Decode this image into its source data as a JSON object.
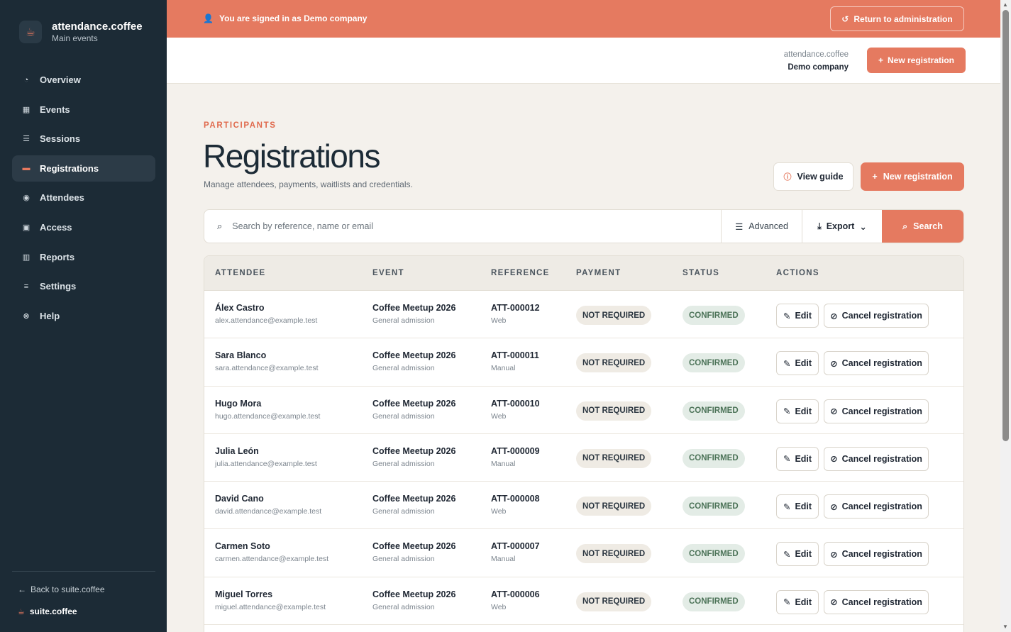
{
  "brand": {
    "name": "attendance.coffee",
    "subtitle": "Main events"
  },
  "sidebar": {
    "items": [
      {
        "label": "Overview",
        "icon": "◔"
      },
      {
        "label": "Events",
        "icon": "▦"
      },
      {
        "label": "Sessions",
        "icon": "☰"
      },
      {
        "label": "Registrations",
        "icon": "▬",
        "active": true
      },
      {
        "label": "Attendees",
        "icon": "◉"
      },
      {
        "label": "Access",
        "icon": "▣"
      },
      {
        "label": "Reports",
        "icon": "▥"
      },
      {
        "label": "Settings",
        "icon": "≡"
      },
      {
        "label": "Help",
        "icon": "⊗"
      }
    ],
    "back_link": "Back to suite.coffee",
    "suite_label": "suite.coffee"
  },
  "banner": {
    "text": "You are signed in as Demo company",
    "return_label": "Return to administration"
  },
  "header": {
    "org_top": "attendance.coffee",
    "org_name": "Demo company",
    "new_label": "New registration"
  },
  "page": {
    "eyebrow": "PARTICIPANTS",
    "title": "Registrations",
    "subtitle": "Manage attendees, payments, waitlists and credentials.",
    "guide_label": "View guide",
    "new_label": "New registration"
  },
  "search": {
    "placeholder": "Search by reference, name or email",
    "advanced_label": "Advanced",
    "export_label": "Export",
    "search_label": "Search"
  },
  "table": {
    "headers": {
      "attendee": "ATTENDEE",
      "event": "EVENT",
      "reference": "REFERENCE",
      "payment": "PAYMENT",
      "status": "STATUS",
      "actions": "ACTIONS"
    },
    "edit_label": "Edit",
    "cancel_label": "Cancel registration",
    "rows": [
      {
        "name": "Álex Castro",
        "email": "alex.attendance@example.test",
        "event": "Coffee Meetup 2026",
        "ticket": "General admission",
        "ref": "ATT-000012",
        "channel": "Web",
        "payment": "NOT REQUIRED",
        "status": "CONFIRMED"
      },
      {
        "name": "Sara Blanco",
        "email": "sara.attendance@example.test",
        "event": "Coffee Meetup 2026",
        "ticket": "General admission",
        "ref": "ATT-000011",
        "channel": "Manual",
        "payment": "NOT REQUIRED",
        "status": "CONFIRMED"
      },
      {
        "name": "Hugo Mora",
        "email": "hugo.attendance@example.test",
        "event": "Coffee Meetup 2026",
        "ticket": "General admission",
        "ref": "ATT-000010",
        "channel": "Web",
        "payment": "NOT REQUIRED",
        "status": "CONFIRMED"
      },
      {
        "name": "Julia León",
        "email": "julia.attendance@example.test",
        "event": "Coffee Meetup 2026",
        "ticket": "General admission",
        "ref": "ATT-000009",
        "channel": "Manual",
        "payment": "NOT REQUIRED",
        "status": "CONFIRMED"
      },
      {
        "name": "David Cano",
        "email": "david.attendance@example.test",
        "event": "Coffee Meetup 2026",
        "ticket": "General admission",
        "ref": "ATT-000008",
        "channel": "Web",
        "payment": "NOT REQUIRED",
        "status": "CONFIRMED"
      },
      {
        "name": "Carmen Soto",
        "email": "carmen.attendance@example.test",
        "event": "Coffee Meetup 2026",
        "ticket": "General admission",
        "ref": "ATT-000007",
        "channel": "Manual",
        "payment": "NOT REQUIRED",
        "status": "CONFIRMED"
      },
      {
        "name": "Miguel Torres",
        "email": "miguel.attendance@example.test",
        "event": "Coffee Meetup 2026",
        "ticket": "General admission",
        "ref": "ATT-000006",
        "channel": "Web",
        "payment": "NOT REQUIRED",
        "status": "CONFIRMED"
      }
    ]
  },
  "colors": {
    "accent": "#e57a60",
    "sidebar": "#1c2b36",
    "background": "#f4f1ec",
    "status_green": "#4c7358"
  }
}
